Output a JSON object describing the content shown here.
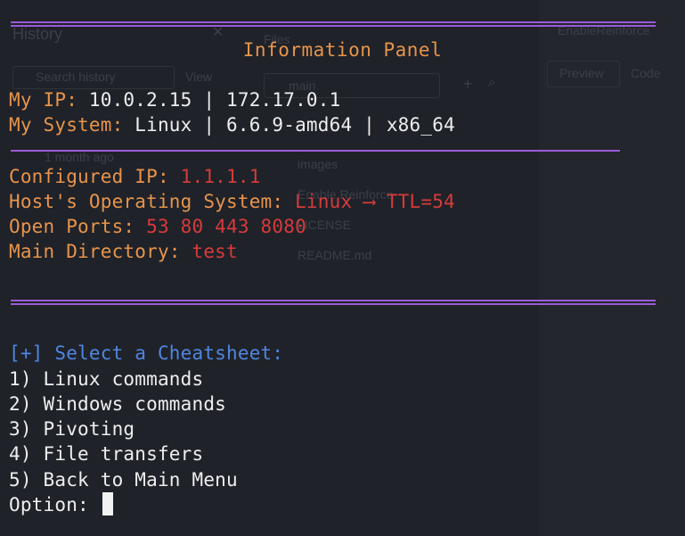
{
  "background_ghost": {
    "history_title": "History",
    "search_history": "Search history",
    "view": "View",
    "files_title": "Files",
    "branch": "main",
    "tree_images": "images",
    "tree_file1": "Enable Reinforce",
    "tree_license": "LICENSE",
    "tree_readme": "README.md",
    "age": "1 month ago",
    "right_title": "EnableReinforce",
    "preview_tab": "Preview",
    "code_tab": "Code"
  },
  "panel": {
    "title": "Information Panel",
    "my_ip_label": "My IP: ",
    "my_ip_value": "10.0.2.15 | 172.17.0.1",
    "my_system_label": "My System: ",
    "my_system_value": "Linux | 6.6.9-amd64 | x86_64",
    "configured_ip_label": "Configured IP: ",
    "configured_ip_value": "1.1.1.1",
    "host_os_label": "Host's Operating System: ",
    "host_os_value": "Linux ⟶ TTL=54",
    "open_ports_label": "Open Ports: ",
    "open_ports_value": "53 80 443 8080",
    "main_dir_label": "Main Directory: ",
    "main_dir_value": "test"
  },
  "menu": {
    "prompt": "[+] Select a Cheatsheet:",
    "options": [
      "1) Linux commands",
      "2) Windows commands",
      "3) Pivoting",
      "4) File transfers",
      "5) Back to Main Menu"
    ],
    "input_label": "Option: ",
    "input_value": ""
  },
  "colors": {
    "background": "#1f2229",
    "label": "#e8944b",
    "value": "#eeeeee",
    "highlight": "#d63b3b",
    "prompt": "#4f86e0",
    "rule": "#9a5bd6"
  }
}
